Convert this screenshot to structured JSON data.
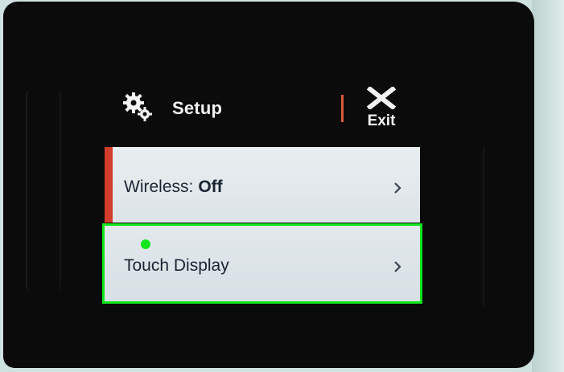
{
  "header": {
    "title": "Setup",
    "exit_label": "Exit"
  },
  "menu": {
    "items": [
      {
        "label": "Wireless:",
        "value": "Off",
        "selected": true
      },
      {
        "label": "Touch Display",
        "value": ""
      }
    ]
  },
  "icons": {
    "settings": "gear-icon",
    "close": "close-icon",
    "chevron": "chevron-right-icon"
  },
  "colors": {
    "accent_red": "#d23d2c",
    "highlight_green": "#11e51c",
    "screen_bg": "#0b0b0b"
  }
}
